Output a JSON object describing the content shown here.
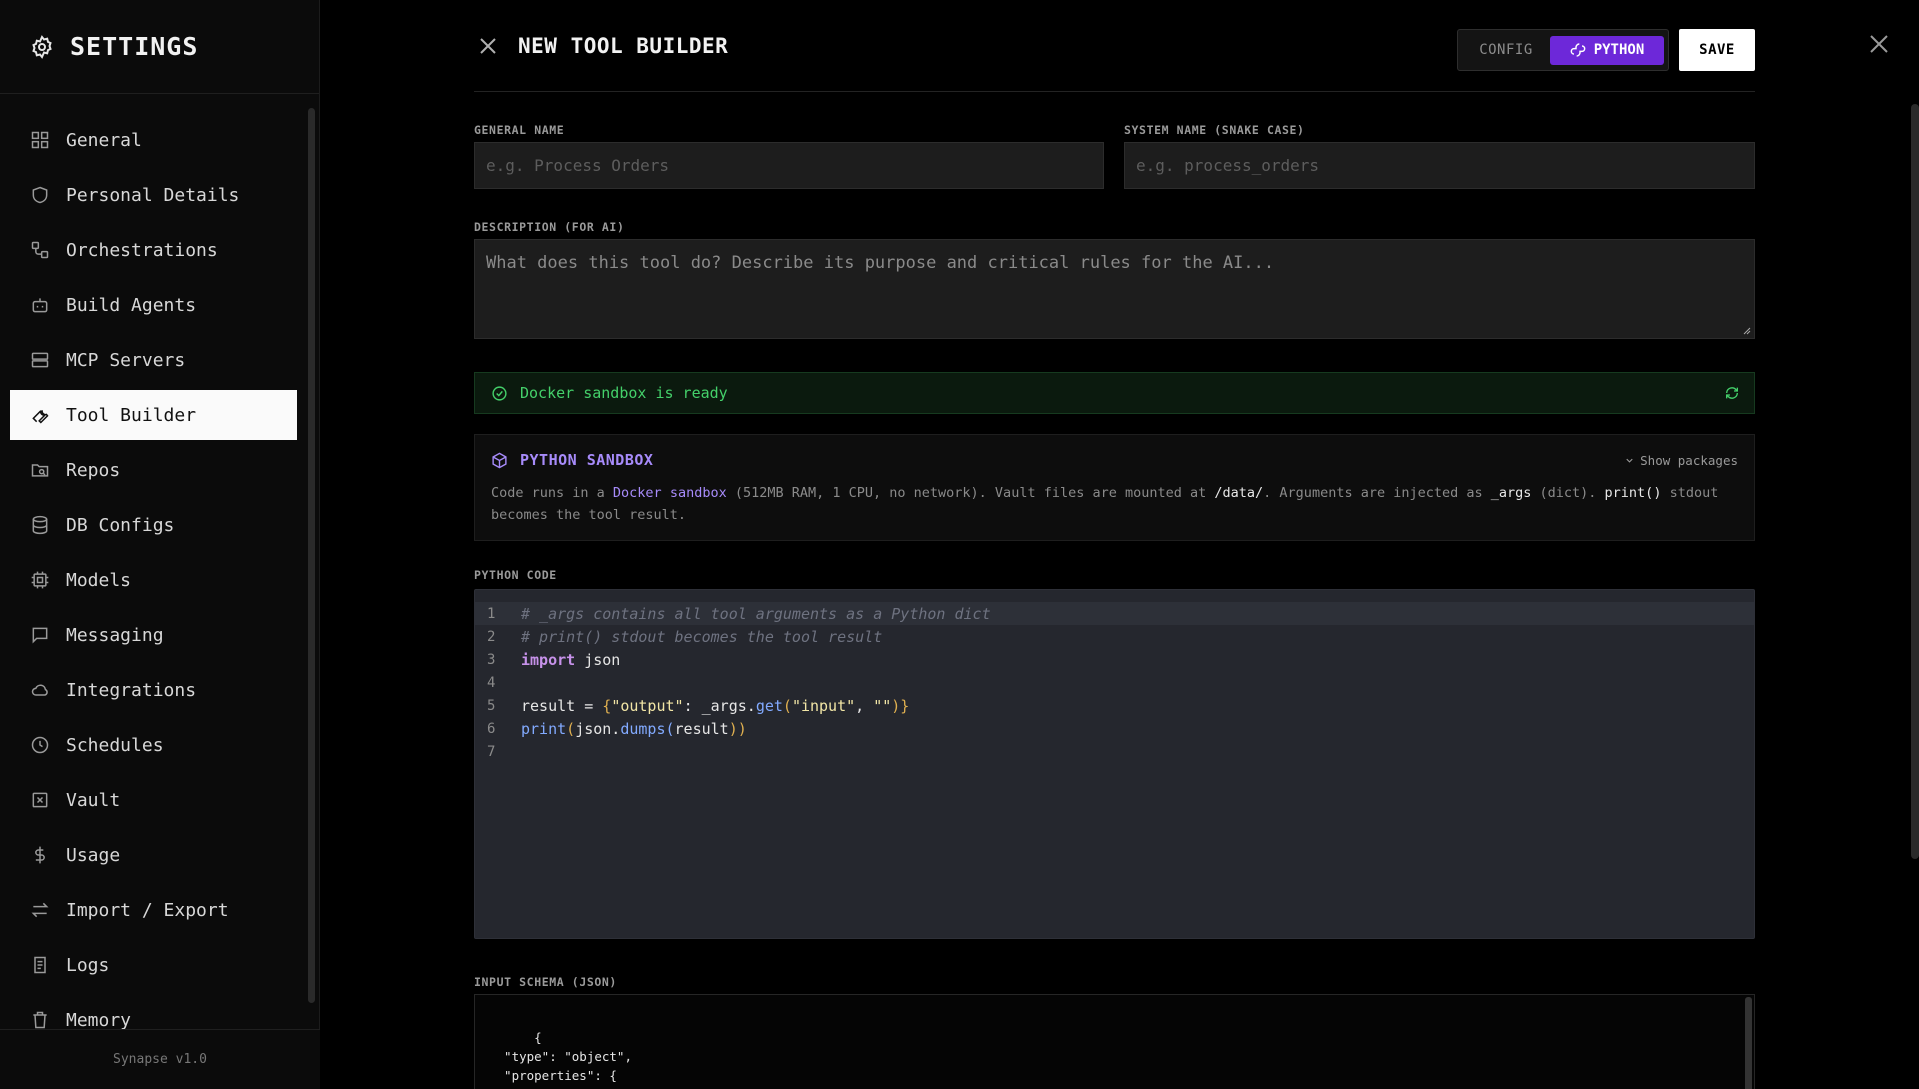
{
  "sidebar": {
    "title": "SETTINGS",
    "items": [
      {
        "label": "General",
        "icon": "grid-icon"
      },
      {
        "label": "Personal Details",
        "icon": "shield-icon"
      },
      {
        "label": "Orchestrations",
        "icon": "workflow-icon"
      },
      {
        "label": "Build Agents",
        "icon": "bot-icon"
      },
      {
        "label": "MCP Servers",
        "icon": "server-icon"
      },
      {
        "label": "Tool Builder",
        "icon": "wrench-icon",
        "active": true
      },
      {
        "label": "Repos",
        "icon": "folder-search-icon"
      },
      {
        "label": "DB Configs",
        "icon": "database-icon"
      },
      {
        "label": "Models",
        "icon": "cpu-icon"
      },
      {
        "label": "Messaging",
        "icon": "message-icon"
      },
      {
        "label": "Integrations",
        "icon": "cloud-icon"
      },
      {
        "label": "Schedules",
        "icon": "clock-icon"
      },
      {
        "label": "Vault",
        "icon": "vault-icon"
      },
      {
        "label": "Usage",
        "icon": "dollar-icon"
      },
      {
        "label": "Import / Export",
        "icon": "arrows-icon"
      },
      {
        "label": "Logs",
        "icon": "logs-icon"
      },
      {
        "label": "Memory",
        "icon": "trash-icon"
      }
    ],
    "footer": "Synapse v1.0"
  },
  "header": {
    "title": "NEW TOOL BUILDER",
    "mode_config": "CONFIG",
    "mode_python": "PYTHON",
    "save": "SAVE"
  },
  "form": {
    "general_name_label": "GENERAL NAME",
    "general_name_placeholder": "e.g. Process Orders",
    "system_name_label": "SYSTEM NAME (SNAKE CASE)",
    "system_name_placeholder": "e.g. process_orders",
    "description_label": "DESCRIPTION (FOR AI)",
    "description_placeholder": "What does this tool do? Describe its purpose and critical rules for the AI..."
  },
  "status": {
    "text": "Docker sandbox is ready"
  },
  "sandbox": {
    "title": "PYTHON SANDBOX",
    "show_packages": "Show packages",
    "t1": "Code runs in a ",
    "t2": "Docker sandbox",
    "t3": " (512MB RAM, 1 CPU, no network). Vault files are mounted at ",
    "t4": "/data/",
    "t5": ". Arguments are injected as ",
    "t6": "_args",
    "t7": " (dict). ",
    "t8": "print()",
    "t9": " stdout",
    "t10": "becomes the tool result."
  },
  "code": {
    "label": "PYTHON CODE",
    "line_numbers": [
      "1",
      "2",
      "3",
      "4",
      "5",
      "6",
      "7"
    ],
    "l1": "# _args contains all tool arguments as a Python dict",
    "l2": "# print() stdout becomes the tool result",
    "l3_kw": "import",
    "l3_rest": " json",
    "l5_a": "result = ",
    "l5_b": "{",
    "l5_c": "\"output\"",
    "l5_d": ": _args.",
    "l5_e": "get",
    "l5_f": "(",
    "l5_g": "\"input\"",
    "l5_h": ", ",
    "l5_i": "\"\"",
    "l5_j": ")}",
    "l6_a": "print",
    "l6_b": "(",
    "l6_c": "json.",
    "l6_d": "dumps",
    "l6_e": "(",
    "l6_f": "result",
    "l6_g": "))"
  },
  "schema": {
    "label": "INPUT SCHEMA (JSON)",
    "text": "{\n  \"type\": \"object\",\n  \"properties\": {\n    \"input\": {"
  },
  "colors": {
    "accent": "#6d28d9",
    "accent_text": "#a78bfa",
    "success": "#44d06a"
  }
}
